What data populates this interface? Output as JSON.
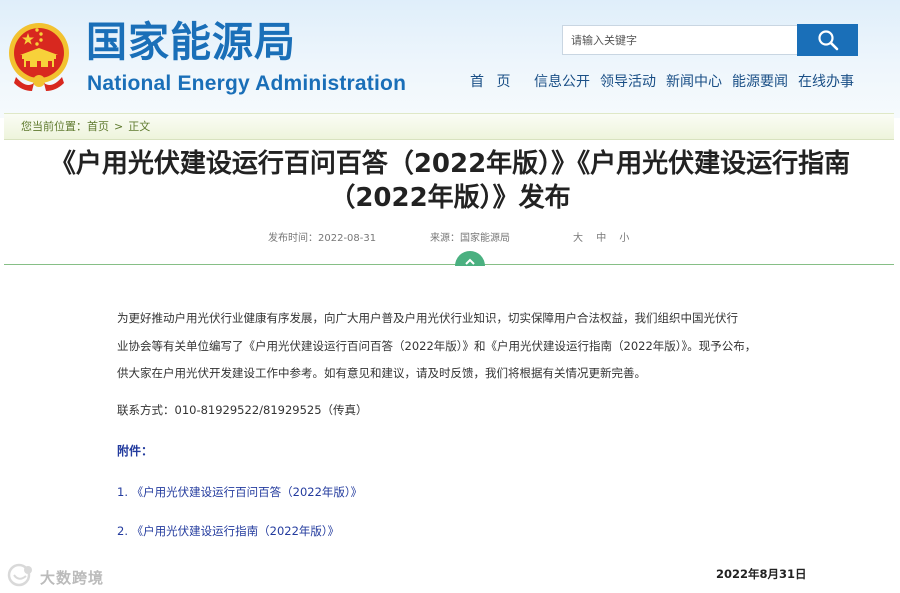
{
  "header": {
    "logo_cn": "国家能源局",
    "logo_en": "National Energy Administration",
    "search_placeholder": "请输入关键字",
    "nav": [
      "首 页",
      "信息公开",
      "领导活动",
      "新闻中心",
      "能源要闻",
      "在线办事"
    ]
  },
  "breadcrumb": {
    "label": "您当前位置：",
    "home": "首页",
    "separator": ">",
    "current": "正文"
  },
  "article": {
    "title_line1": "《户用光伏建设运行百问百答（2022年版）》《户用光伏建设运行指南",
    "title_line2": "（2022年版）》发布",
    "publish_time": "发布时间：2022-08-31",
    "source": "来源：国家能源局",
    "font_sizes": [
      "大",
      "中",
      "小"
    ],
    "paragraph_lines": [
      "为更好推动户用光伏行业健康有序发展，向广大用户普及户用光伏行业知识，切实保障用户合法权益，我们组织中国光伏行",
      "业协会等有关单位编写了《户用光伏建设运行百问百答（2022年版）》和《户用光伏建设运行指南（2022年版）》。现予公布，",
      "供大家在户用光伏开发建设工作中参考。如有意见和建议，请及时反馈，我们将根据有关情况更新完善。"
    ],
    "contact": "联系方式：010-81929522/81929525（传真）",
    "attachments_label": "附件：",
    "attachments": [
      "1. 《户用光伏建设运行百问百答（2022年版）》",
      "2. 《户用光伏建设运行指南（2022年版）》"
    ],
    "date": "2022年8月31日"
  },
  "watermark": {
    "text": "大数跨境"
  },
  "colors": {
    "brand_blue": "#1a6fb8",
    "link_blue": "#233b9e",
    "breadcrumb_green": "#5f7a2e",
    "toggle_green": "#4ab080"
  },
  "icons": [
    "national-emblem-icon",
    "search-icon",
    "chevron-up-icon",
    "watermark-logo-icon"
  ]
}
